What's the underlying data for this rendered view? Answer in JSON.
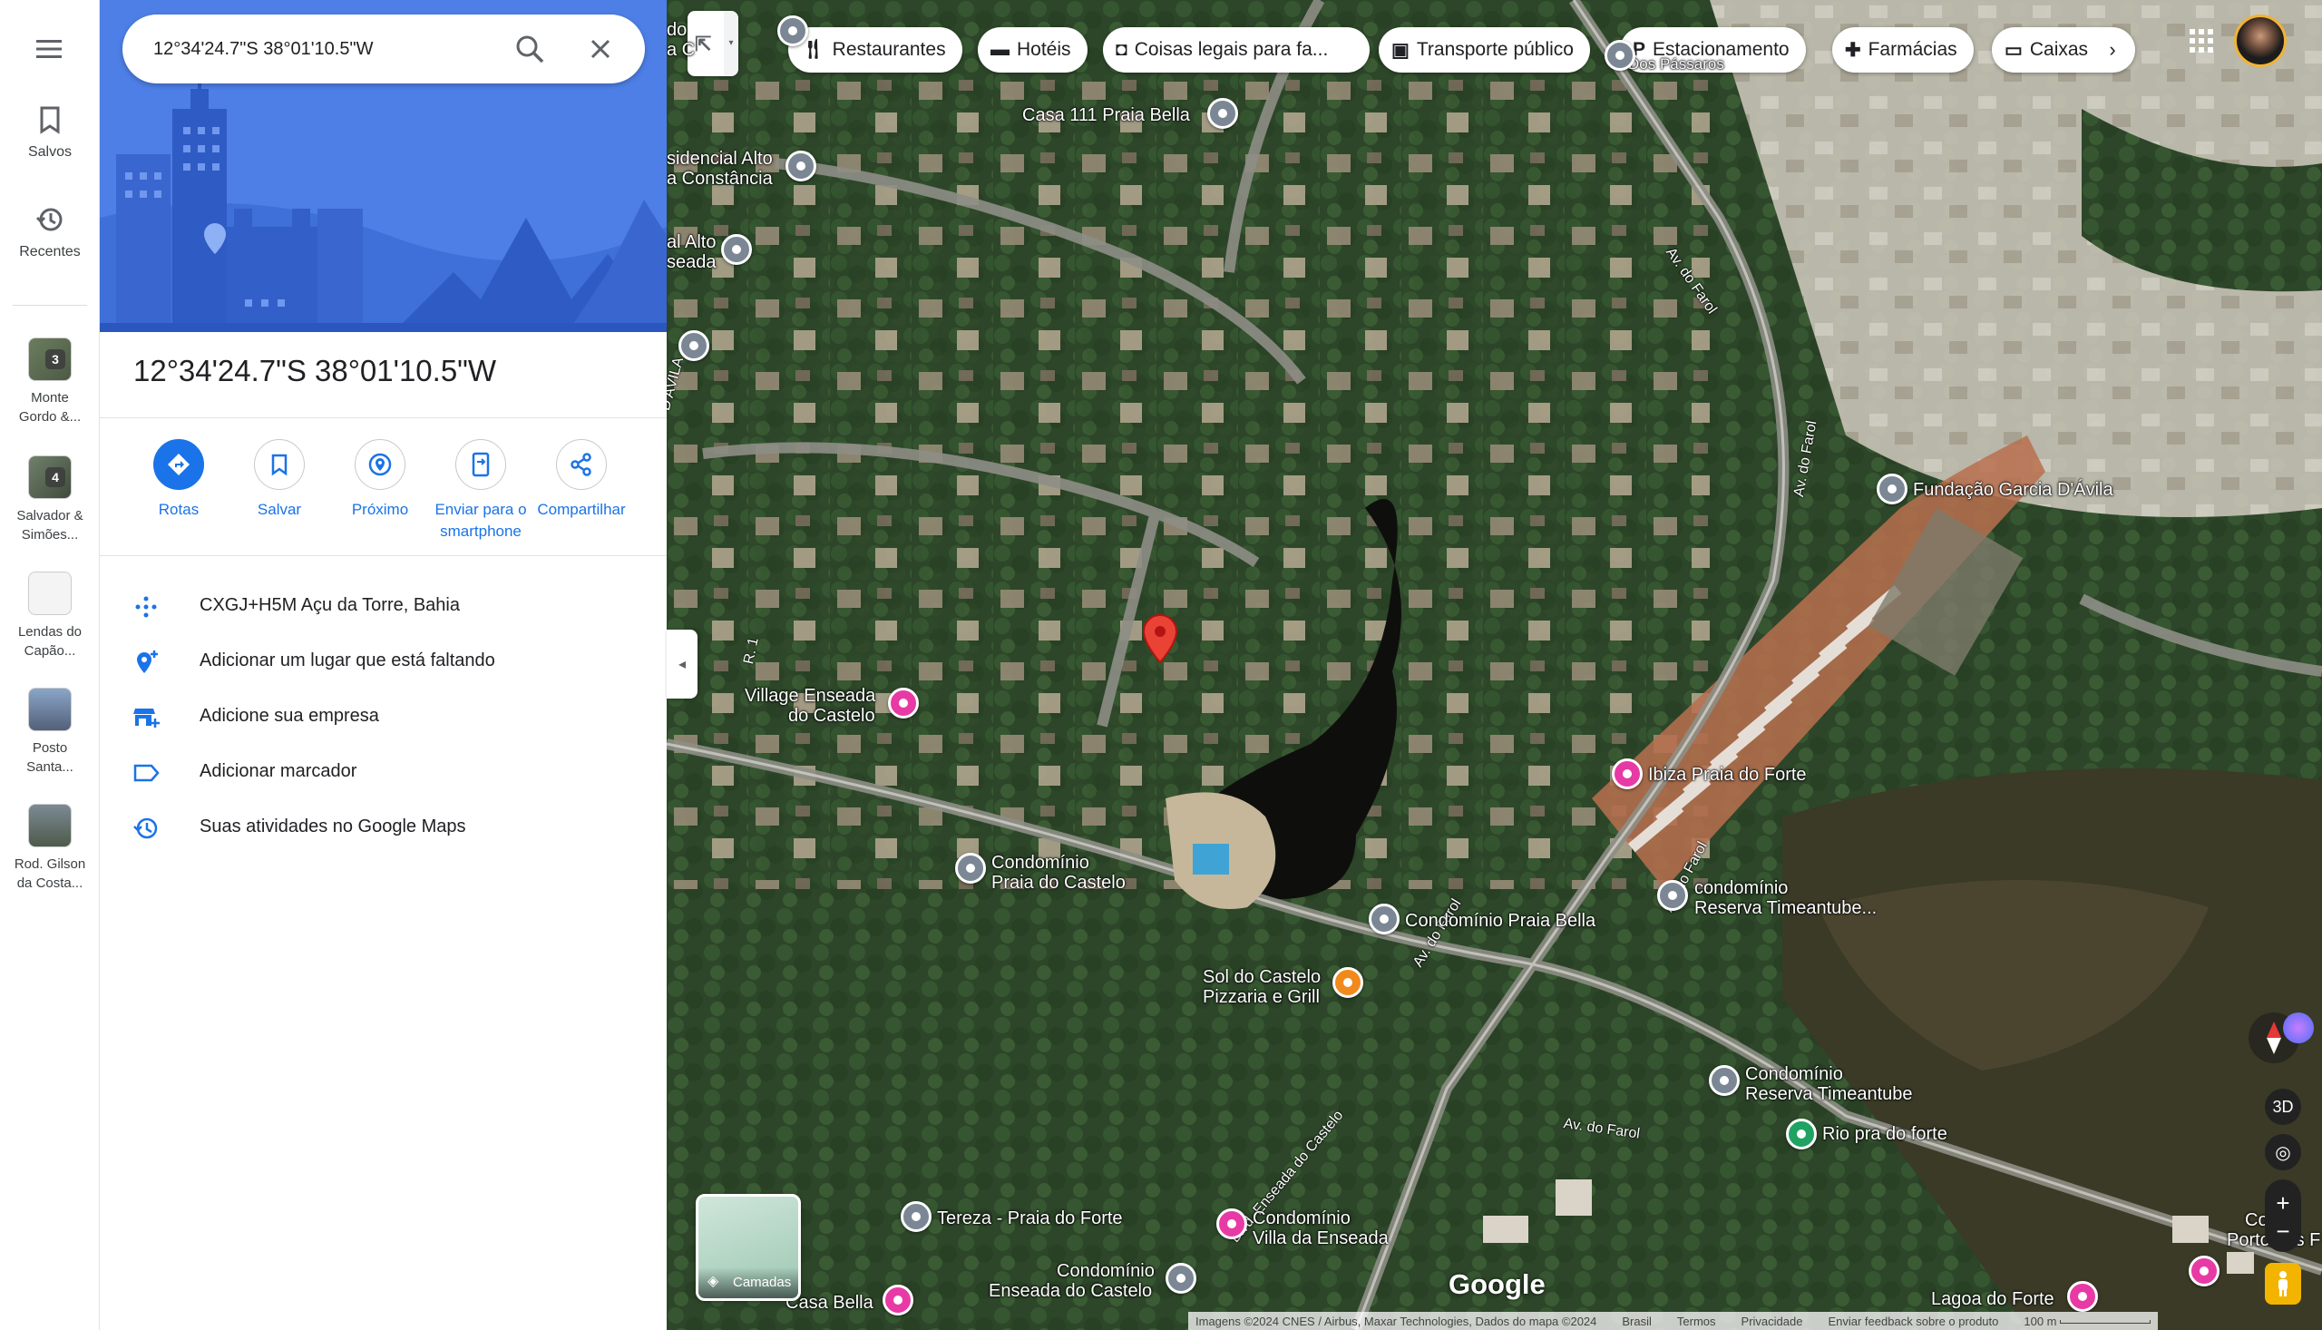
{
  "rail": {
    "menu_icon": "hamburger-menu-icon",
    "saved_label": "Salvos",
    "recents_label": "Recentes",
    "recent_places": [
      {
        "label_line1": "Monte",
        "label_line2": "Gordo &...",
        "badge": "3"
      },
      {
        "label_line1": "Salvador &",
        "label_line2": "Simões...",
        "badge": "4"
      },
      {
        "label_line1": "Lendas do",
        "label_line2": "Capão...",
        "badge": ""
      },
      {
        "label_line1": "Posto",
        "label_line2": "Santa...",
        "badge": ""
      },
      {
        "label_line1": "Rod. Gilson",
        "label_line2": "da Costa...",
        "badge": ""
      }
    ]
  },
  "search": {
    "value": "12°34'24.7\"S 38°01'10.5\"W"
  },
  "place": {
    "title": "12°34'24.7\"S 38°01'10.5\"W",
    "actions": [
      {
        "label": "Rotas",
        "icon": "directions-icon"
      },
      {
        "label": "Salvar",
        "icon": "bookmark-icon"
      },
      {
        "label": "Próximo",
        "icon": "nearby-icon"
      },
      {
        "label_line1": "Enviar para o",
        "label_line2": "smartphone",
        "icon": "send-to-phone-icon"
      },
      {
        "label": "Compartilhar",
        "icon": "share-icon"
      }
    ],
    "details": [
      {
        "text": "CXGJ+H5M Açu da Torre, Bahia",
        "icon": "plus-code-icon"
      },
      {
        "text": "Adicionar um lugar que está faltando",
        "icon": "add-place-icon"
      },
      {
        "text": "Adicione sua empresa",
        "icon": "add-business-icon"
      },
      {
        "text": "Adicionar marcador",
        "icon": "label-icon"
      },
      {
        "text": "Suas atividades no Google Maps",
        "icon": "history-icon"
      }
    ]
  },
  "chips": [
    {
      "label": "Restaurantes",
      "icon": "restaurant-icon"
    },
    {
      "label": "Hotéis",
      "icon": "hotel-icon"
    },
    {
      "label": "Coisas legais para fa...",
      "icon": "camera-icon"
    },
    {
      "label": "Transporte público",
      "icon": "transit-icon"
    },
    {
      "label": "Estacionamento",
      "icon": "parking-icon"
    },
    {
      "label": "Farmácias",
      "icon": "pharmacy-icon"
    },
    {
      "label": "Caixas",
      "icon": "atm-icon"
    }
  ],
  "map_labels": {
    "casa111": "Casa 111 Praia Bella",
    "residencial_l1": "sidencial Alto",
    "residencial_l2": "a Constância",
    "alto_l1": "al Alto",
    "alto_l2": "seada",
    "dos_passaros": "Dos Pássaros",
    "fundacao": "Fundação Garcia D'Ávila",
    "village_l1": "Village Enseada",
    "village_l2": "do Castelo",
    "ibiza": "Ibiza Praia do Forte",
    "cond_praia_castelo_l1": "Condomínio",
    "cond_praia_castelo_l2": "Praia do Castelo",
    "cond_praia_bella": "Condomínio Praia Bella",
    "reserva1_l1": "condomínio",
    "reserva1_l2": "Reserva Timeantube...",
    "sol_l1": "Sol do Castelo",
    "sol_l2": "Pizzaria e Grill",
    "reserva2_l1": "Condomínio",
    "reserva2_l2": "Reserva Timeantube",
    "rio": "Rio pra do forte",
    "tereza": "Tereza - Praia do Forte",
    "villa_l1": "Condomínio",
    "villa_l2": "Villa da Enseada",
    "enseada_l1": "Condomínio",
    "enseada_l2": "Enseada do Castelo",
    "casa_bella": "Casa Bella",
    "lagoa": "Lagoa do Forte",
    "cond_porto_l1": "Cond",
    "cond_porto_l2": "Porto das F",
    "do_l1": "do",
    "do_l2": "a C"
  },
  "roads": {
    "av_farol_1": "Av. do Farol",
    "av_farol_2": "Av. do Farol",
    "av_farol_3": "Av. do Farol",
    "av_farol_4": "Av. do Farol",
    "av_farol_5": "Av. do Farol",
    "blvd": "Blvd. Enseada do Castelo",
    "davila": "D'ÁVILA",
    "r1": "R. 1"
  },
  "layers_label": "Camadas",
  "controls": {
    "three_d": "3D"
  },
  "google_logo": "Google",
  "footer": {
    "imagery": "Imagens ©2024 CNES / Airbus, Maxar Technologies, Dados do mapa ©2024",
    "country": "Brasil",
    "terms": "Termos",
    "privacy": "Privacidade",
    "feedback": "Enviar feedback sobre o produto",
    "scale": "100 m"
  },
  "colors": {
    "accent": "#1a73e8",
    "hero": "#4d7fe6",
    "pin_red": "#ea4335"
  }
}
